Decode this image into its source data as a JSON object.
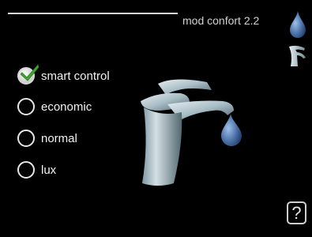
{
  "header": {
    "title": "mod confort 2.2"
  },
  "options": [
    {
      "label": "smart control",
      "selected": true
    },
    {
      "label": "economic",
      "selected": false
    },
    {
      "label": "normal",
      "selected": false
    },
    {
      "label": "lux",
      "selected": false
    }
  ],
  "help": {
    "label": "?"
  },
  "colors": {
    "background": "#000000",
    "check_green": "#3fa82f",
    "drop_blue": "#4a6fa5",
    "faucet_metal": "#a9bdc6"
  },
  "icons": {
    "header": [
      "water-drop-icon",
      "tap-icon"
    ],
    "main": "faucet-illustration",
    "help": "help-icon"
  }
}
